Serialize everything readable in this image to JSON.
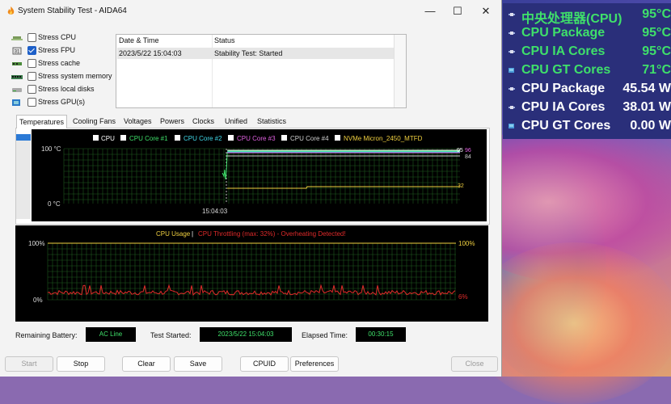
{
  "window": {
    "title": "System Stability Test - AIDA64"
  },
  "window_controls": {
    "minimize": "—",
    "maximize": "☐",
    "close": "✕"
  },
  "stress_options": [
    {
      "label": "Stress CPU",
      "checked": false
    },
    {
      "label": "Stress FPU",
      "checked": true
    },
    {
      "label": "Stress cache",
      "checked": false
    },
    {
      "label": "Stress system memory",
      "checked": false
    },
    {
      "label": "Stress local disks",
      "checked": false
    },
    {
      "label": "Stress GPU(s)",
      "checked": false
    }
  ],
  "log": {
    "columns": [
      "Date & Time",
      "Status"
    ],
    "rows": [
      {
        "datetime": "2023/5/22 15:04:03",
        "status": "Stability Test: Started"
      }
    ]
  },
  "tabs": [
    "Temperatures",
    "Cooling Fans",
    "Voltages",
    "Powers",
    "Clocks",
    "Unified",
    "Statistics"
  ],
  "active_tab": "Temperatures",
  "temp_graph": {
    "legend": [
      {
        "label": "CPU",
        "color": "#ffffff"
      },
      {
        "label": "CPU Core #1",
        "color": "#3fe06a"
      },
      {
        "label": "CPU Core #2",
        "color": "#40d8e8"
      },
      {
        "label": "CPU Core #3",
        "color": "#e060e0"
      },
      {
        "label": "CPU Core #4",
        "color": "#cfcfcf"
      },
      {
        "label": "NVMe Micron_2450_MTFD",
        "color": "#f0d040"
      }
    ],
    "y_top": "100 °C",
    "y_bottom": "0 °C",
    "time_label": "15:04:03",
    "readouts": [
      "95",
      "96",
      "84",
      "32"
    ]
  },
  "usage_graph": {
    "title_a": "CPU Usage",
    "separator": "|",
    "title_b": "CPU Throttling (max: 32%) - Overheating Detected!",
    "left_top": "100%",
    "left_bottom": "0%",
    "right_top": "100%",
    "right_bottom": "6%"
  },
  "status": {
    "battery_label": "Remaining Battery:",
    "battery_value": "AC Line",
    "started_label": "Test Started:",
    "started_value": "2023/5/22 15:04:03",
    "elapsed_label": "Elapsed Time:",
    "elapsed_value": "00:30:15"
  },
  "buttons": [
    "Start",
    "Stop",
    "Clear",
    "Save",
    "CPUID",
    "Preferences",
    "Close"
  ],
  "osd": [
    {
      "label": "中央处理器(CPU)",
      "value": "95°C",
      "color": "green"
    },
    {
      "label": "CPU Package",
      "value": "95°C",
      "color": "green"
    },
    {
      "label": "CPU IA Cores",
      "value": "95°C",
      "color": "green"
    },
    {
      "label": "CPU GT Cores",
      "value": "71°C",
      "color": "green"
    },
    {
      "label": "CPU Package",
      "value": "45.54 W",
      "color": "white"
    },
    {
      "label": "CPU IA Cores",
      "value": "38.01 W",
      "color": "white"
    },
    {
      "label": "CPU GT Cores",
      "value": "0.00 W",
      "color": "white"
    }
  ]
}
